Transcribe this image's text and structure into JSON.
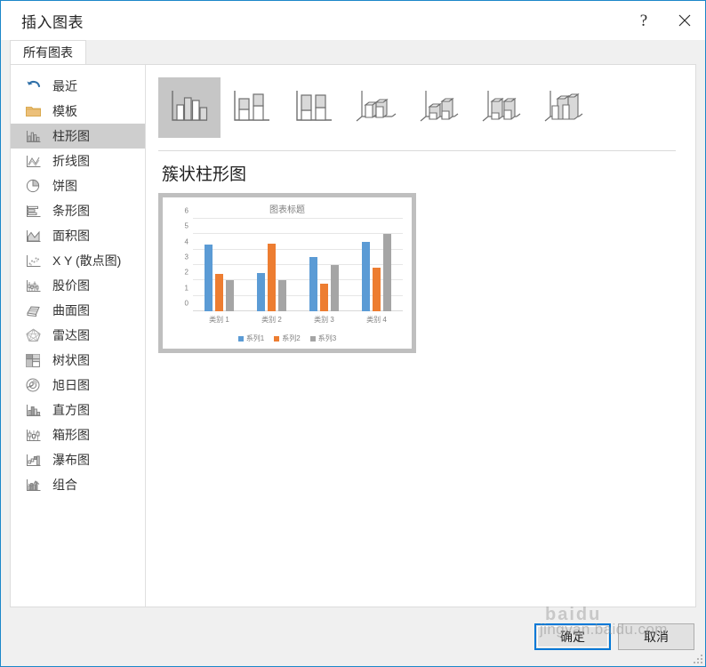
{
  "window": {
    "title": "插入图表",
    "help_icon": "help-question-icon",
    "help_label": "?",
    "close_icon": "close-icon"
  },
  "tabs": [
    {
      "label": "所有图表",
      "selected": true
    }
  ],
  "sidebar": {
    "items": [
      {
        "label": "最近",
        "icon": "recent-undo-icon",
        "selected": false
      },
      {
        "label": "模板",
        "icon": "folder-template-icon",
        "selected": false
      },
      {
        "label": "柱形图",
        "icon": "column-chart-icon",
        "selected": true
      },
      {
        "label": "折线图",
        "icon": "line-chart-icon",
        "selected": false
      },
      {
        "label": "饼图",
        "icon": "pie-chart-icon",
        "selected": false
      },
      {
        "label": "条形图",
        "icon": "bar-chart-icon",
        "selected": false
      },
      {
        "label": "面积图",
        "icon": "area-chart-icon",
        "selected": false
      },
      {
        "label": "X Y (散点图)",
        "icon": "scatter-chart-icon",
        "selected": false
      },
      {
        "label": "股价图",
        "icon": "stock-chart-icon",
        "selected": false
      },
      {
        "label": "曲面图",
        "icon": "surface-chart-icon",
        "selected": false
      },
      {
        "label": "雷达图",
        "icon": "radar-chart-icon",
        "selected": false
      },
      {
        "label": "树状图",
        "icon": "treemap-chart-icon",
        "selected": false
      },
      {
        "label": "旭日图",
        "icon": "sunburst-chart-icon",
        "selected": false
      },
      {
        "label": "直方图",
        "icon": "histogram-chart-icon",
        "selected": false
      },
      {
        "label": "箱形图",
        "icon": "boxplot-chart-icon",
        "selected": false
      },
      {
        "label": "瀑布图",
        "icon": "waterfall-chart-icon",
        "selected": false
      },
      {
        "label": "组合",
        "icon": "combo-chart-icon",
        "selected": false
      }
    ]
  },
  "thumbnails": [
    {
      "name": "clustered-column",
      "selected": true
    },
    {
      "name": "stacked-column",
      "selected": false
    },
    {
      "name": "100-stacked-column",
      "selected": false
    },
    {
      "name": "3d-clustered-column",
      "selected": false
    },
    {
      "name": "3d-stacked-column",
      "selected": false
    },
    {
      "name": "3d-100-stacked-column",
      "selected": false
    },
    {
      "name": "3d-column",
      "selected": false
    }
  ],
  "preview": {
    "heading": "簇状柱形图"
  },
  "chart_data": {
    "type": "bar",
    "title": "图表标题",
    "xlabel": "",
    "ylabel": "",
    "categories": [
      "类别 1",
      "类别 2",
      "类别 3",
      "类别 4"
    ],
    "series": [
      {
        "name": "系列1",
        "color": "#5B9BD5",
        "values": [
          4.3,
          2.5,
          3.5,
          4.5
        ]
      },
      {
        "name": "系列2",
        "color": "#ED7D31",
        "values": [
          2.4,
          4.4,
          1.8,
          2.8
        ]
      },
      {
        "name": "系列3",
        "color": "#A5A5A5",
        "values": [
          2.0,
          2.0,
          3.0,
          5.0
        ]
      }
    ],
    "ylim": [
      0,
      6
    ],
    "yticks": [
      0,
      1,
      2,
      3,
      4,
      5,
      6
    ],
    "grid": true,
    "legend_position": "bottom"
  },
  "footer": {
    "ok_label": "确定",
    "cancel_label": "取消"
  },
  "watermark": {
    "line1": "jingyan.baidu.com",
    "line2": "baidu"
  },
  "colors": {
    "accent": "#0078d7",
    "title_border": "#1b87c9",
    "series1": "#5B9BD5",
    "series2": "#ED7D31",
    "series3": "#A5A5A5",
    "selection": "#cecece"
  }
}
